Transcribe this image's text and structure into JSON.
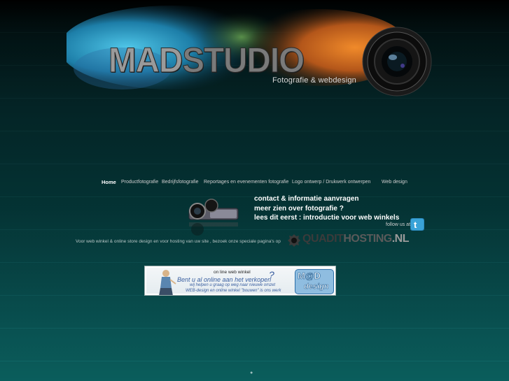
{
  "header": {
    "logo_text_a": "MAD",
    "logo_text_b": "STUDIO",
    "tagline": "Fotografie  & webdesign"
  },
  "nav": {
    "items": [
      {
        "label": "Home",
        "active": true
      },
      {
        "label": "Productfotografie"
      },
      {
        "label": "Bedrijfsfotografie"
      },
      {
        "label": "Reportages en evenementen fotografie"
      },
      {
        "label": "Logo ontwerp / Drukwerk ontwerpen"
      },
      {
        "label": "Web design"
      }
    ]
  },
  "links": {
    "contact": "contact & informatie aanvragen",
    "more_photo": "meer zien over fotografie ?",
    "intro_shops": "lees dit eerst : introductie voor web winkels"
  },
  "social": {
    "follow_label": "follow us at",
    "icon": "twitter-icon"
  },
  "promo": {
    "text": "Voor web winkel & online store design  en voor hosting van uw site , bezoek onze speciale  pagina's op",
    "partner_a": "QUADIT",
    "partner_b": "HOSTING",
    "partner_c": ".NL"
  },
  "banner": {
    "line1": "on line web winkel",
    "line2": "Bent u al online aan het verkopen",
    "question": "?",
    "line3": "wij helpen u graag op weg naar nieuwe omzet",
    "line4": "WEB-design en online winkel \"bouwen\" is ons werk",
    "badge_top": "M@D",
    "badge_bottom": "design"
  },
  "colors": {
    "bg_top": "#000000",
    "bg_bottom": "#0b6866",
    "link": "#ffffff"
  }
}
